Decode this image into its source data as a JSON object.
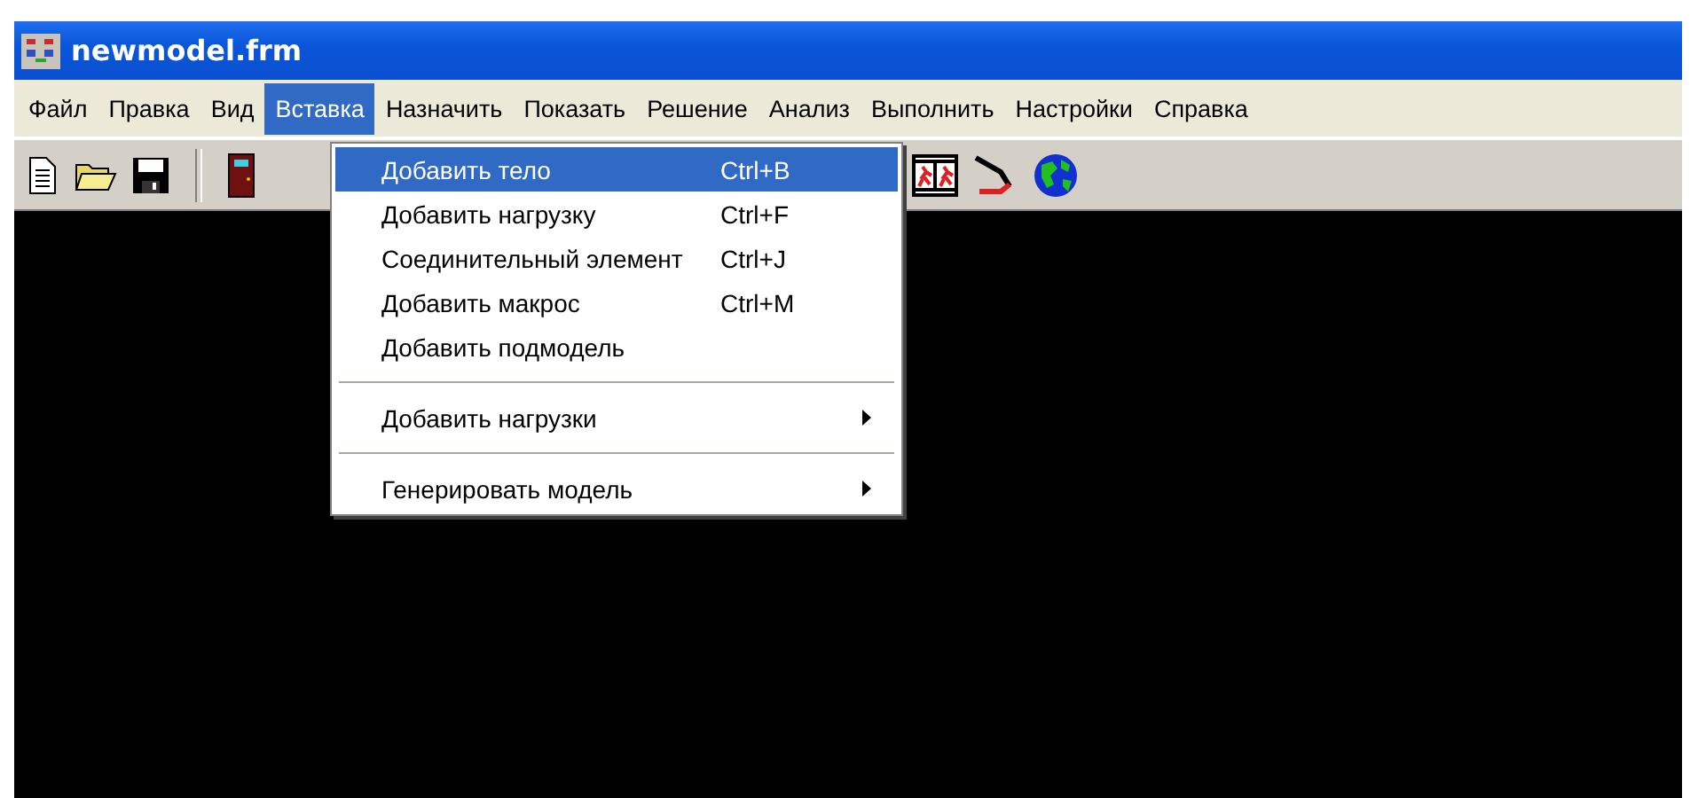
{
  "window": {
    "title": "newmodel.frm"
  },
  "menu_bar": [
    {
      "label": "Файл",
      "selected": false
    },
    {
      "label": "Правка",
      "selected": false
    },
    {
      "label": "Вид",
      "selected": false
    },
    {
      "label": "Вставка",
      "selected": true
    },
    {
      "label": "Назначить",
      "selected": false
    },
    {
      "label": "Показать",
      "selected": false
    },
    {
      "label": "Решение",
      "selected": false
    },
    {
      "label": "Анализ",
      "selected": false
    },
    {
      "label": "Выполнить",
      "selected": false
    },
    {
      "label": "Настройки",
      "selected": false
    },
    {
      "label": "Справка",
      "selected": false
    }
  ],
  "dropdown_menu": {
    "items": [
      {
        "kind": "item",
        "label": "Добавить тело",
        "shortcut": "Ctrl+B",
        "selected": true
      },
      {
        "kind": "item",
        "label": "Добавить нагрузку",
        "shortcut": "Ctrl+F",
        "selected": false
      },
      {
        "kind": "item",
        "label": "Соединительный элемент",
        "shortcut": "Ctrl+J",
        "selected": false
      },
      {
        "kind": "item",
        "label": "Добавить макрос",
        "shortcut": "Ctrl+M",
        "selected": false
      },
      {
        "kind": "item",
        "label": "Добавить подмодель",
        "selected": false
      },
      {
        "kind": "separator"
      },
      {
        "kind": "submenu",
        "label": "Добавить нагрузки",
        "selected": false
      },
      {
        "kind": "separator"
      },
      {
        "kind": "submenu",
        "label": "Генерировать модель",
        "selected": false
      }
    ]
  }
}
